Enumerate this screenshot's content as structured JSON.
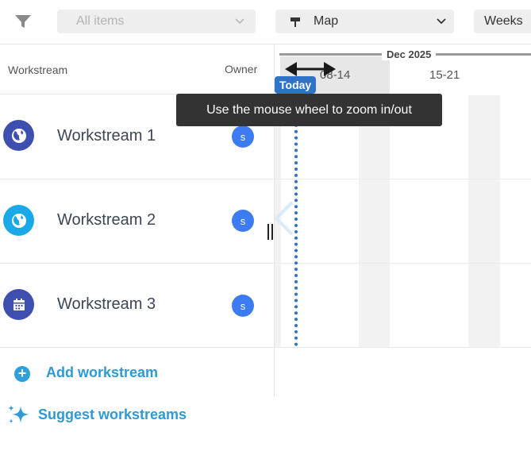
{
  "toolbar": {
    "filter_icon": "filter-icon",
    "items_select": {
      "value": "All items",
      "icon": "chevron-down-icon"
    },
    "view_select": {
      "value": "Map",
      "icon": "signpost-icon"
    },
    "zoom_select": {
      "value": "Weeks"
    }
  },
  "table": {
    "headers": {
      "workstream": "Workstream",
      "owner": "Owner"
    },
    "rows": [
      {
        "name": "Workstream 1",
        "icon": "globe-icon",
        "icon_color": "#3f4fb0",
        "owner_initial": "s"
      },
      {
        "name": "Workstream 2",
        "icon": "globe-icon",
        "icon_color": "#1aa9e8",
        "owner_initial": "s"
      },
      {
        "name": "Workstream 3",
        "icon": "calendar-icon",
        "icon_color": "#3f4fb0",
        "owner_initial": "s"
      }
    ],
    "add_label": "Add workstream",
    "suggest_label": "Suggest workstreams"
  },
  "timeline": {
    "month": "Dec 2025",
    "weeks": [
      "08-14",
      "15-21"
    ],
    "today_label": "Today",
    "tooltip": "Use the mouse wheel to zoom in/out"
  },
  "colors": {
    "accent": "#2d9ad6",
    "today": "#2f73c8",
    "owner_avatar": "#3d7bf2",
    "tooltip_bg": "#333333"
  }
}
